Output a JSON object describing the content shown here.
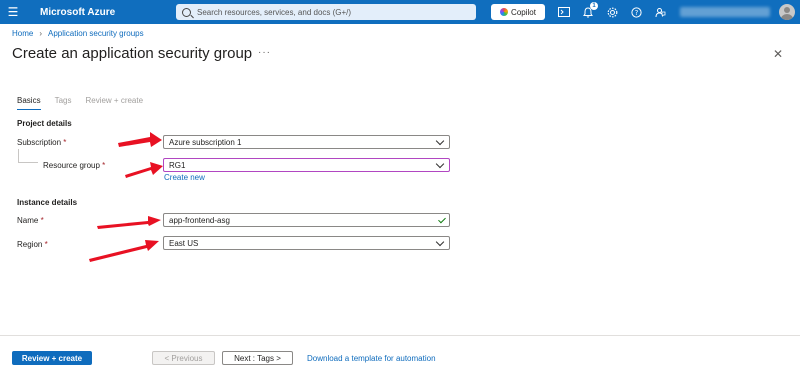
{
  "topbar": {
    "brand": "Microsoft Azure",
    "search_placeholder": "Search resources, services, and docs (G+/)",
    "copilot_label": "Copilot",
    "notifications_count": "1",
    "icons": [
      "terminal-icon",
      "bell-icon",
      "gear-icon",
      "help-icon",
      "feedback-icon"
    ]
  },
  "breadcrumb": {
    "home": "Home",
    "parent": "Application security groups"
  },
  "page": {
    "title": "Create an application security group",
    "more": "···",
    "close": "✕"
  },
  "tabs": [
    {
      "label": "Basics",
      "active": true
    },
    {
      "label": "Tags",
      "active": false
    },
    {
      "label": "Review + create",
      "active": false
    }
  ],
  "project_details": {
    "heading": "Project details",
    "subscription_label": "Subscription",
    "subscription_value": "Azure subscription 1",
    "resource_group_label": "Resource group",
    "resource_group_value": "RG1",
    "create_new": "Create new"
  },
  "instance_details": {
    "heading": "Instance details",
    "name_label": "Name",
    "name_value": "app-frontend-asg",
    "region_label": "Region",
    "region_value": "East US"
  },
  "required_marker": "*",
  "footer": {
    "review_create": "Review + create",
    "previous": "< Previous",
    "next": "Next : Tags >",
    "download": "Download a template for automation"
  },
  "colors": {
    "topbar": "#106ebe",
    "link": "#0f6cbd",
    "annotation_arrow": "#e81123",
    "focus_border": "#b146c2"
  }
}
